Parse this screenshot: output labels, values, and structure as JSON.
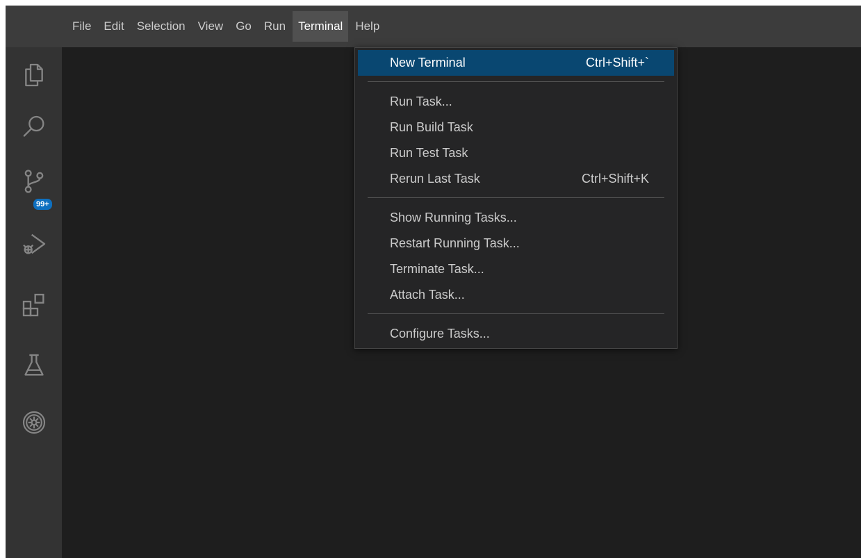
{
  "menubar": {
    "items": [
      {
        "label": "File"
      },
      {
        "label": "Edit"
      },
      {
        "label": "Selection"
      },
      {
        "label": "View"
      },
      {
        "label": "Go"
      },
      {
        "label": "Run"
      },
      {
        "label": "Terminal"
      },
      {
        "label": "Help"
      }
    ],
    "active": "Terminal"
  },
  "activitybar": {
    "icons": [
      "explorer-icon",
      "search-icon",
      "source-control-icon",
      "run-debug-icon",
      "extensions-icon",
      "testing-icon",
      "gitlens-icon"
    ],
    "source_control_badge": "99+"
  },
  "terminal_menu": {
    "groups": [
      [
        {
          "label": "New Terminal",
          "shortcut": "Ctrl+Shift+`",
          "highlighted": true
        }
      ],
      [
        {
          "label": "Run Task...",
          "shortcut": ""
        },
        {
          "label": "Run Build Task",
          "shortcut": ""
        },
        {
          "label": "Run Test Task",
          "shortcut": ""
        },
        {
          "label": "Rerun Last Task",
          "shortcut": "Ctrl+Shift+K"
        }
      ],
      [
        {
          "label": "Show Running Tasks...",
          "shortcut": ""
        },
        {
          "label": "Restart Running Task...",
          "shortcut": ""
        },
        {
          "label": "Terminate Task...",
          "shortcut": ""
        },
        {
          "label": "Attach Task...",
          "shortcut": ""
        }
      ],
      [
        {
          "label": "Configure Tasks...",
          "shortcut": ""
        }
      ]
    ]
  },
  "colors": {
    "menubar_bg": "#3c3c3c",
    "activitybar_bg": "#333333",
    "editor_bg": "#1e1e1e",
    "menu_bg": "#252526",
    "highlight": "#094771",
    "badge": "#0e70c0"
  }
}
